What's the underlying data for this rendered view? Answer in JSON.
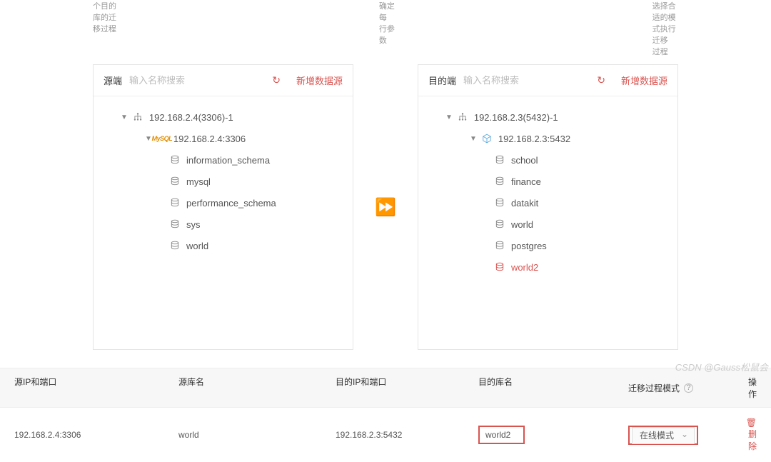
{
  "topdesc": {
    "c1": "个目的库的迁移过程",
    "c2": "确定每\n行参数",
    "c3": "选择合适的模式执行迁移\n过程"
  },
  "panels": {
    "source": {
      "title": "源端",
      "search_ph": "输入名称搜索",
      "add": "新增数据源",
      "root": "192.168.2.4(3306)-1",
      "host": "192.168.2.4:3306",
      "dbs": [
        "information_schema",
        "mysql",
        "performance_schema",
        "sys",
        "world"
      ]
    },
    "target": {
      "title": "目的端",
      "search_ph": "输入名称搜索",
      "add": "新增数据源",
      "root": "192.168.2.3(5432)-1",
      "host": "192.168.2.3:5432",
      "dbs": [
        "school",
        "finance",
        "datakit",
        "world",
        "postgres"
      ],
      "dbs_hl": "world2"
    }
  },
  "table": {
    "head": {
      "a": "源IP和端口",
      "b": "源库名",
      "c": "目的IP和端口",
      "d": "目的库名",
      "e": "迁移过程模式",
      "f": "操作"
    },
    "row": {
      "a": "192.168.2.4:3306",
      "b": "world",
      "c": "192.168.2.3:5432",
      "d": "world2",
      "e": "在线模式",
      "f": "删除"
    }
  },
  "watermark": "CSDN @Gauss松鼠会"
}
